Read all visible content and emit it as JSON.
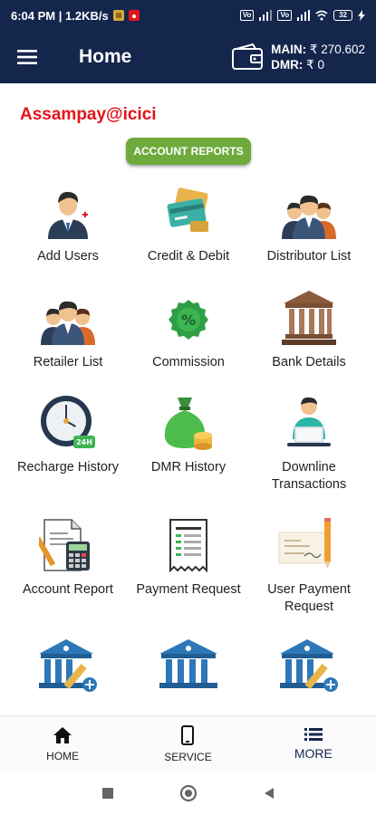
{
  "status_bar": {
    "time_speed": "6:04 PM | 1.2KB/s",
    "signal1": "Vo",
    "signal2": "Vo",
    "battery": "32"
  },
  "app_bar": {
    "title": "Home",
    "main_label": "MAIN:",
    "main_amount": "₹ 270.602",
    "dmr_label": "DMR:",
    "dmr_amount": "₹ 0"
  },
  "brand": "Assampay@icici",
  "section_button": "ACCOUNT REPORTS",
  "tiles": [
    {
      "label": "Add Users",
      "icon": "add-user-icon"
    },
    {
      "label": "Credit & Debit",
      "icon": "credit-card-icon"
    },
    {
      "label": "Distributor List",
      "icon": "group-icon"
    },
    {
      "label": "Retailer List",
      "icon": "group-icon"
    },
    {
      "label": "Commission",
      "icon": "percent-badge-icon"
    },
    {
      "label": "Bank Details",
      "icon": "bank-icon"
    },
    {
      "label": "Recharge History",
      "icon": "clock-24h-icon"
    },
    {
      "label": "DMR History",
      "icon": "money-bag-icon"
    },
    {
      "label": "Downline Transactions",
      "icon": "user-laptop-icon"
    },
    {
      "label": "Account Report",
      "icon": "report-calculator-icon"
    },
    {
      "label": "Payment Request",
      "icon": "receipt-icon"
    },
    {
      "label": "User Payment Request",
      "icon": "cheque-icon"
    },
    {
      "label": "",
      "icon": "bank-edit-icon"
    },
    {
      "label": "",
      "icon": "bank-icon"
    },
    {
      "label": "",
      "icon": "bank-edit-icon"
    }
  ],
  "bottom_nav": {
    "home": "HOME",
    "service": "SERVICE",
    "more": "MORE"
  },
  "colors": {
    "primary": "#15264d",
    "brand_red": "#e3141b",
    "accent_green": "#6eab3c"
  }
}
